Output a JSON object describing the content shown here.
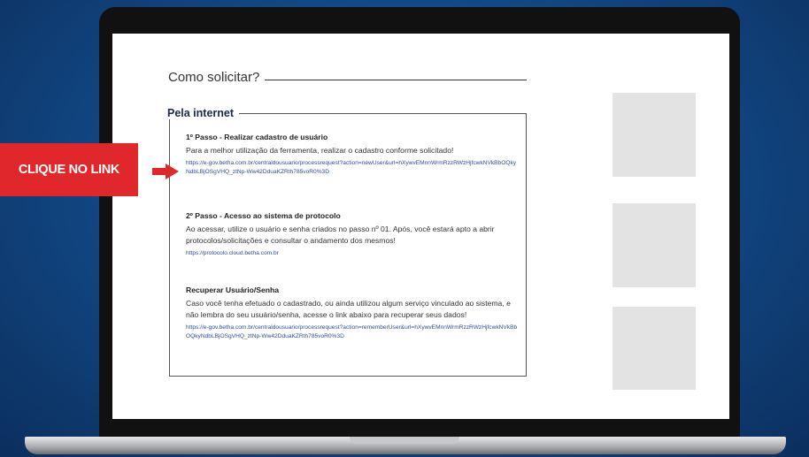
{
  "page": {
    "heading": "Como solicitar?",
    "section_title": "Pela internet",
    "steps": [
      {
        "title": "1º Passo - Realizar cadastro de usuário",
        "text": "Para a melhor utilização da ferramenta, realizar o cadastro conforme solicitado!",
        "link": "https://e-gov.betha.com.br/centraldousuario/processrequest?action=newUser&url=hXywvEMnnWrmRzzRWzHjfcwkNVkBbOQkyNdbLBjOSgVHQ_ztNp-Ww42DduaKZRth785voR0%3D"
      },
      {
        "title": "2º Passo - Acesso ao sistema de protocolo",
        "text": "Ao acessar, utilize o usuário e senha criados no passo nº 01. Após, você estará apto a abrir protocolos/solicitações e consultar o andamento dos mesmos!",
        "link": "https://protocolo.cloud.betha.com.br"
      },
      {
        "title": "Recuperar Usuário/Senha",
        "text": "Caso você tenha efetuado o cadastrado, ou ainda utilizou algum serviço vinculado ao sistema, e não lembra do seu usuário/senha, acesse o link abaixo para recuperar seus dados!",
        "link": "https://e-gov.betha.com.br/centraldousuario/processrequest?action=rememberUser&url=hXywvEMnnWrmRzzRWzHjfcwkNVkBbOQkyNdbLBjOSgVHQ_ztNp-Ww42DduaKZRth785voR0%3D"
      }
    ]
  },
  "callout": {
    "label": "CLIQUE NO LINK",
    "color": "#e0272b"
  },
  "icons": {
    "arrow": "arrow-right-icon"
  }
}
